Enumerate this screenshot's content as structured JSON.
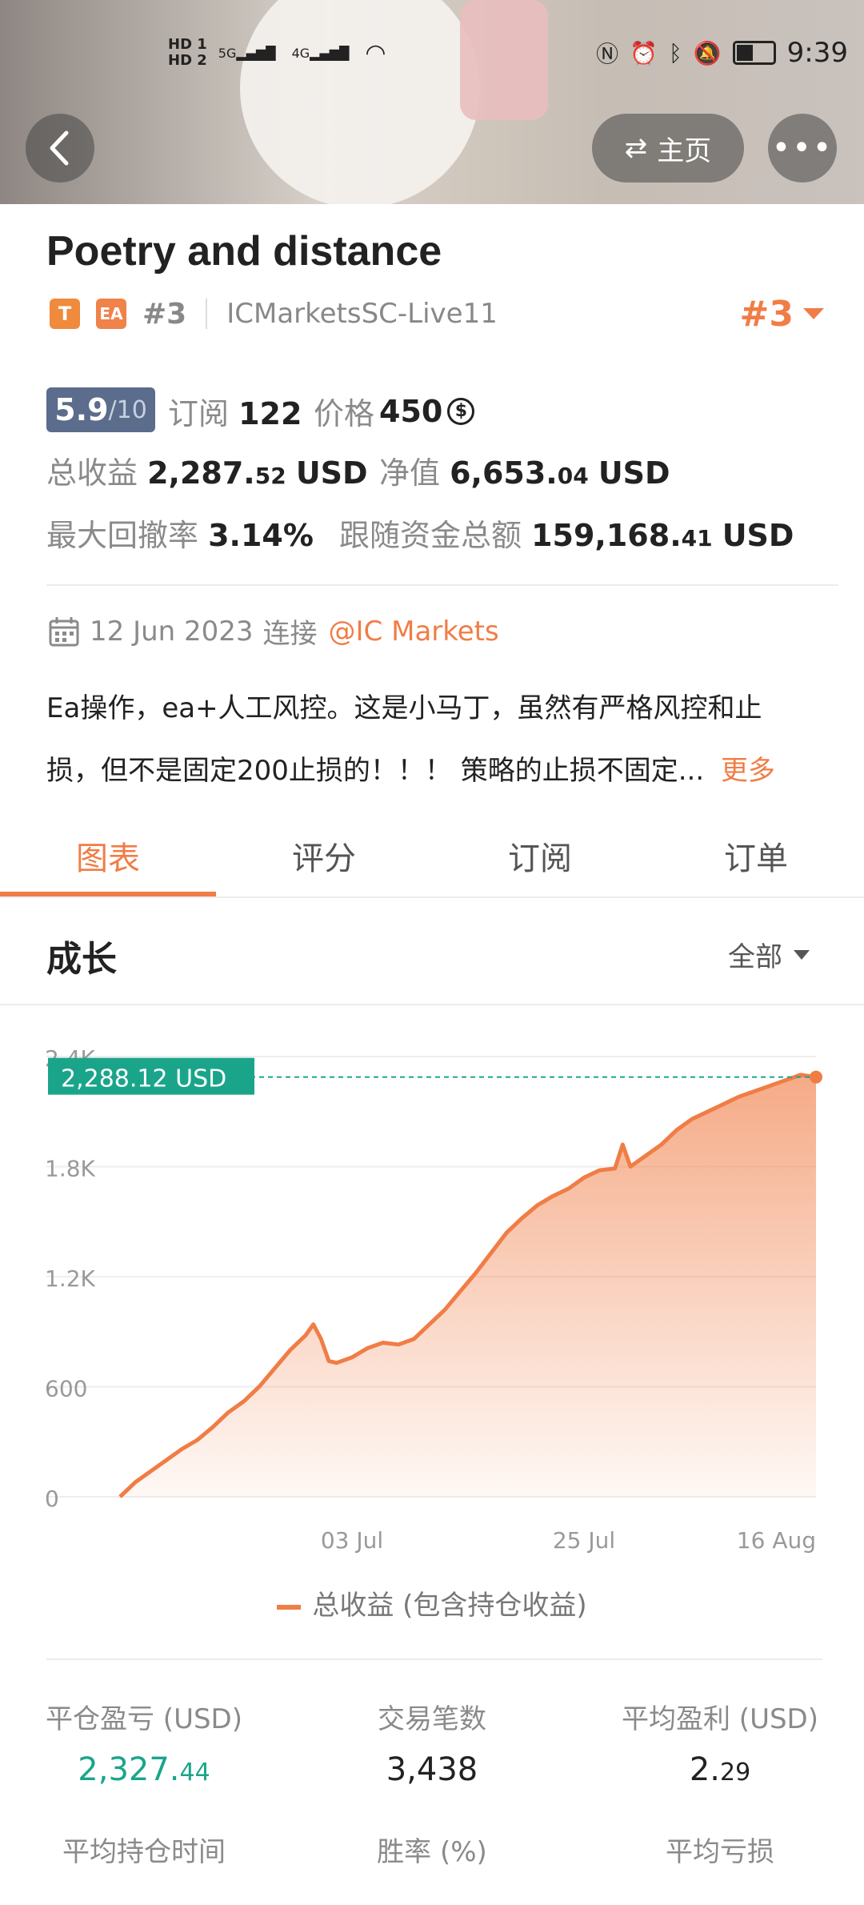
{
  "status_bar": {
    "left_indicators": [
      "HD 1",
      "HD 2",
      "5G",
      "4G"
    ],
    "time": "9:39"
  },
  "header": {
    "home_label": "主页"
  },
  "profile": {
    "name": "Poetry and distance",
    "badge_t": "T",
    "badge_ea": "EA",
    "rank": "#3",
    "server": "ICMarketsSC-Live11",
    "rank_right": "#3"
  },
  "metrics": {
    "rating": "5.9",
    "rating_max": "/10",
    "subscribe_label": "订阅",
    "subscribe_count": "122",
    "price_label": "价格",
    "price_value": "450",
    "total_profit_label": "总收益",
    "total_profit_int": "2,287.",
    "total_profit_dec": "52",
    "total_profit_unit": "USD",
    "equity_label": "净值",
    "equity_int": "6,653.",
    "equity_dec": "04",
    "equity_unit": "USD",
    "drawdown_label": "最大回撤率",
    "drawdown_value": "3.14%",
    "follow_label": "跟随资金总额",
    "follow_int": "159,168.",
    "follow_dec": "41",
    "follow_unit": "USD"
  },
  "connection": {
    "date": "12 Jun 2023",
    "connect_label": "连接",
    "broker": "@IC Markets"
  },
  "description": {
    "line1": "Ea操作，ea+人工风控。这是小马丁，虽然有严格风控和止",
    "line2": "损，但不是固定200止损的！！！ 策略的止损不固定...",
    "more": "更多"
  },
  "tabs": [
    "图表",
    "评分",
    "订阅",
    "订单"
  ],
  "section": {
    "title": "成长",
    "filter": "全部"
  },
  "chart_data": {
    "type": "area",
    "x_ticks": [
      "03 Jul",
      "25 Jul",
      "16 Aug"
    ],
    "y_ticks": [
      "0",
      "600",
      "1.2K",
      "1.8K",
      "2.4K"
    ],
    "ylim": [
      0,
      2400
    ],
    "current_label": "2,288.12 USD",
    "current_value": 2288.12,
    "legend": "总收益 (包含持仓收益)",
    "color": "#f07d46",
    "x": [
      0,
      2,
      4,
      6,
      8,
      10,
      12,
      14,
      16,
      18,
      20,
      22,
      24,
      25,
      26,
      27,
      28,
      30,
      32,
      34,
      36,
      38,
      40,
      42,
      44,
      46,
      48,
      50,
      52,
      54,
      56,
      58,
      60,
      62,
      64,
      65,
      66,
      67,
      68,
      70,
      72,
      74,
      76,
      78,
      80,
      82,
      84,
      86,
      88,
      90
    ],
    "values": [
      0,
      80,
      140,
      200,
      260,
      310,
      380,
      460,
      520,
      600,
      700,
      800,
      880,
      940,
      860,
      740,
      730,
      760,
      810,
      840,
      830,
      860,
      940,
      1020,
      1120,
      1220,
      1330,
      1440,
      1520,
      1590,
      1640,
      1680,
      1740,
      1780,
      1790,
      1920,
      1800,
      1830,
      1860,
      1920,
      2000,
      2060,
      2100,
      2140,
      2180,
      2210,
      2240,
      2270,
      2300,
      2288
    ]
  },
  "stats": [
    {
      "label": "平仓盈亏 (USD)",
      "int": "2,327.",
      "dec": "44",
      "color": "#1aa58a"
    },
    {
      "label": "交易笔数",
      "int": "3,438",
      "dec": "",
      "color": "#222222"
    },
    {
      "label": "平均盈利 (USD)",
      "int": "2.",
      "dec": "29",
      "color": "#222222"
    },
    {
      "label": "平均持仓时间",
      "int": "",
      "dec": "",
      "color": "#222222"
    },
    {
      "label": "胜率 (%)",
      "int": "",
      "dec": "",
      "color": "#222222"
    },
    {
      "label": "平均亏损",
      "int": "",
      "dec": "",
      "color": "#222222"
    }
  ]
}
